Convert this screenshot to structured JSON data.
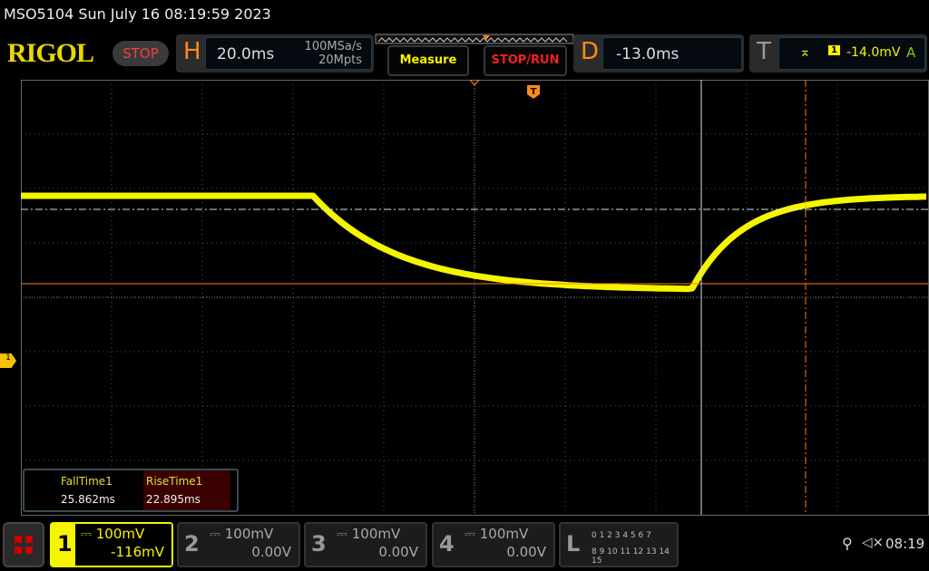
{
  "header": {
    "title": "MSO5104  Sun July 16 08:19:59 2023",
    "logo": "RIGOL",
    "run_state": "STOP"
  },
  "horizontal": {
    "label": "H",
    "timebase": "20.0ms",
    "sample_rate": "100MSa/s",
    "memory_depth": "20Mpts"
  },
  "buttons": {
    "measure": "Measure",
    "stop_run": "STOP/RUN"
  },
  "delay": {
    "label": "D",
    "value": "-13.0ms"
  },
  "trigger": {
    "label": "T",
    "source": "1",
    "level": "-14.0mV",
    "mode": "A"
  },
  "measurements": [
    {
      "name": "FallTime1",
      "value": "25.862ms"
    },
    {
      "name": "RiseTime1",
      "value": "22.895ms"
    }
  ],
  "channels": [
    {
      "num": "1",
      "scale": "100mV",
      "offset": "-116mV",
      "active": true,
      "color": "#f5f500"
    },
    {
      "num": "2",
      "scale": "100mV",
      "offset": "0.00V",
      "active": false
    },
    {
      "num": "3",
      "scale": "100mV",
      "offset": "0.00V",
      "active": false
    },
    {
      "num": "4",
      "scale": "100mV",
      "offset": "0.00V",
      "active": false
    }
  ],
  "logic": {
    "label": "L",
    "row1": "0 1 2 3  4 5 6 7",
    "row2": "8 9 10 11 12 13 14 15"
  },
  "status": {
    "time": "08:19",
    "usb_icon": "usb-icon",
    "sound_icon": "mute-icon"
  },
  "channel_marker": "1",
  "colors": {
    "ch1": "#f5f500",
    "accent": "#ff8c1a",
    "stop": "#f04040"
  }
}
